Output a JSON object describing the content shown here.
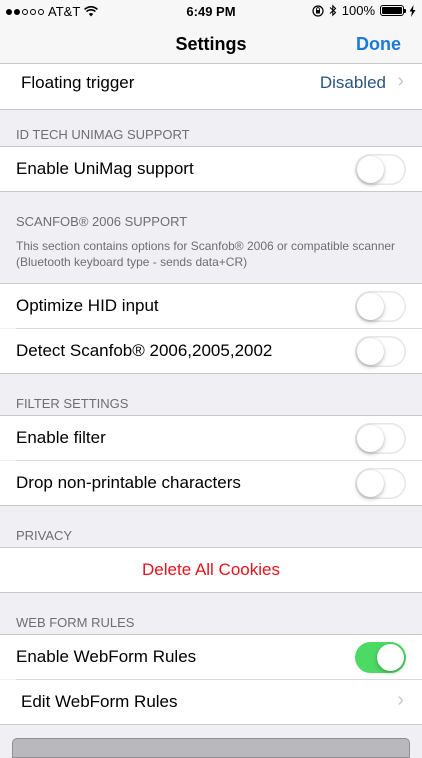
{
  "status_bar": {
    "carrier": "AT&T",
    "time": "6:49 PM",
    "battery_percent": "100%"
  },
  "nav": {
    "title": "Settings",
    "done_label": "Done"
  },
  "floating_trigger": {
    "label": "Floating trigger",
    "value": "Disabled"
  },
  "unimag": {
    "header": "ID TECH UNIMAG SUPPORT",
    "enable_label": "Enable UniMag support",
    "enable_on": false
  },
  "scanfob": {
    "header": "SCANFOB® 2006 SUPPORT",
    "footer": "This section contains options for Scanfob® 2006 or compatible scanner (Bluetooth keyboard type - sends data+CR)",
    "optimize_label": "Optimize HID input",
    "optimize_on": false,
    "detect_label": "Detect Scanfob® 2006,2005,2002",
    "detect_on": false
  },
  "filter": {
    "header": "FILTER SETTINGS",
    "enable_label": "Enable filter",
    "enable_on": false,
    "drop_label": "Drop non-printable characters",
    "drop_on": false
  },
  "privacy": {
    "header": "PRIVACY",
    "delete_label": "Delete All Cookies"
  },
  "webform": {
    "header": "WEB FORM RULES",
    "enable_label": "Enable WebForm Rules",
    "enable_on": true,
    "edit_label": "Edit WebForm Rules"
  },
  "colors": {
    "accent": "#1a7ad9",
    "destructive": "#e5131b",
    "toggle_on": "#4cd964",
    "value_text": "#29557f"
  }
}
